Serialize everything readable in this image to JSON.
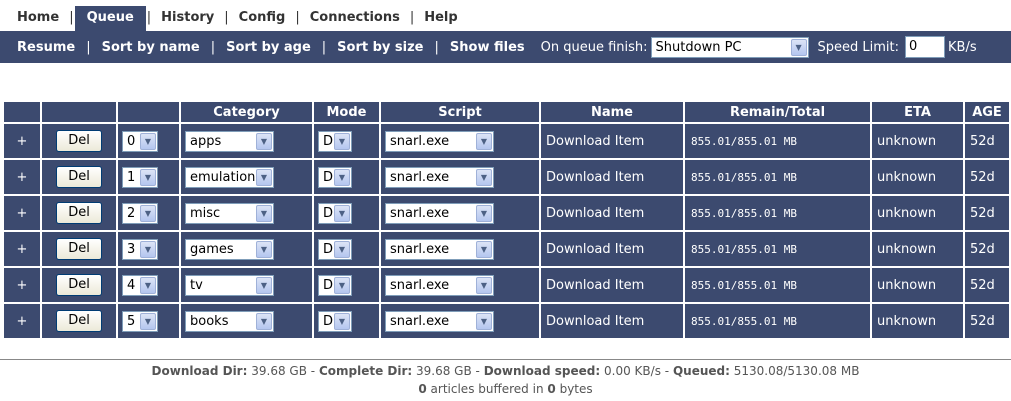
{
  "nav": {
    "items": [
      "Home",
      "Queue",
      "History",
      "Config",
      "Connections",
      "Help"
    ],
    "separator": "|",
    "active": "Queue"
  },
  "toolbar": {
    "resume": "Resume",
    "sort_name": "Sort by name",
    "sort_age": "Sort by age",
    "sort_size": "Sort by size",
    "show_files": "Show files",
    "separator": "|",
    "finish_label": "On queue finish:",
    "finish_value": "Shutdown PC",
    "speed_label": "Speed Limit:",
    "speed_value": "0",
    "speed_unit": "KB/s"
  },
  "table": {
    "headers": {
      "category": "Category",
      "mode": "Mode",
      "script": "Script",
      "name": "Name",
      "remain": "Remain/Total",
      "eta": "ETA",
      "age": "AGE"
    },
    "rows": [
      {
        "expand": "+",
        "del": "Del",
        "priority": "0",
        "category": "apps",
        "mode": "D",
        "script": "snarl.exe",
        "name": "Download Item",
        "remain": "855.01/855.01 MB",
        "eta": "unknown",
        "age": "52d"
      },
      {
        "expand": "+",
        "del": "Del",
        "priority": "1",
        "category": "emulation",
        "mode": "D",
        "script": "snarl.exe",
        "name": "Download Item",
        "remain": "855.01/855.01 MB",
        "eta": "unknown",
        "age": "52d"
      },
      {
        "expand": "+",
        "del": "Del",
        "priority": "2",
        "category": "misc",
        "mode": "D",
        "script": "snarl.exe",
        "name": "Download Item",
        "remain": "855.01/855.01 MB",
        "eta": "unknown",
        "age": "52d"
      },
      {
        "expand": "+",
        "del": "Del",
        "priority": "3",
        "category": "games",
        "mode": "D",
        "script": "snarl.exe",
        "name": "Download Item",
        "remain": "855.01/855.01 MB",
        "eta": "unknown",
        "age": "52d"
      },
      {
        "expand": "+",
        "del": "Del",
        "priority": "4",
        "category": "tv",
        "mode": "D",
        "script": "snarl.exe",
        "name": "Download Item",
        "remain": "855.01/855.01 MB",
        "eta": "unknown",
        "age": "52d"
      },
      {
        "expand": "+",
        "del": "Del",
        "priority": "5",
        "category": "books",
        "mode": "D",
        "script": "snarl.exe",
        "name": "Download Item",
        "remain": "855.01/855.01 MB",
        "eta": "unknown",
        "age": "52d"
      }
    ]
  },
  "status": {
    "download_dir_label": "Download Dir:",
    "download_dir_value": "39.68 GB",
    "complete_dir_label": "Complete Dir:",
    "complete_dir_value": "39.68 GB",
    "speed_label": "Download speed:",
    "speed_value": "0.00 KB/s",
    "queued_label": "Queued:",
    "queued_value": "5130.08/5130.08 MB",
    "dash": "-",
    "articles_count": "0",
    "articles_mid": "articles buffered in",
    "bytes_count": "0",
    "bytes_label": "bytes"
  },
  "colors": {
    "accent": "#3c4a6f",
    "text_on_accent": "#ffffff"
  },
  "icons": {
    "dropdown": "chevron-down-icon"
  }
}
